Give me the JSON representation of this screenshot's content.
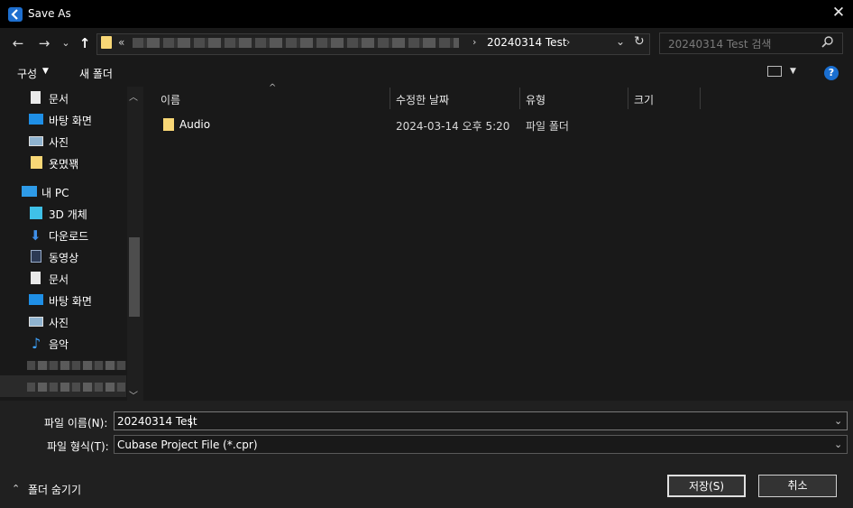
{
  "window": {
    "title": "Save As",
    "close": "✕"
  },
  "nav": {
    "back": "←",
    "forward": "→",
    "recent": "⌄",
    "up": "↑",
    "address_overflow": "«",
    "address_current": "20240314 Test",
    "address_sep": "›",
    "search_placeholder": "20240314 Test 검색"
  },
  "toolbar": {
    "organize": "구성",
    "new_folder": "새 폴더",
    "help": "?"
  },
  "sidebar": {
    "items": [
      {
        "label": "문서",
        "icon": "document-icon"
      },
      {
        "label": "바탕 화면",
        "icon": "desktop-icon"
      },
      {
        "label": "사진",
        "icon": "pictures-icon"
      },
      {
        "label": "욧몄꽦",
        "icon": "folder-icon"
      },
      {
        "label": "내 PC",
        "icon": "pc-icon"
      },
      {
        "label": "3D 개체",
        "icon": "3d-objects-icon"
      },
      {
        "label": "다운로드",
        "icon": "download-icon"
      },
      {
        "label": "동영상",
        "icon": "video-icon"
      },
      {
        "label": "문서",
        "icon": "document-icon"
      },
      {
        "label": "바탕 화면",
        "icon": "desktop-icon"
      },
      {
        "label": "사진",
        "icon": "pictures-icon"
      },
      {
        "label": "음악",
        "icon": "music-icon"
      }
    ]
  },
  "filelist": {
    "columns": [
      "이름",
      "수정한 날짜",
      "유형",
      "크기"
    ],
    "rows": [
      {
        "name": "Audio",
        "modified": "2024-03-14 오후 5:20",
        "type": "파일 폴더",
        "size": ""
      }
    ]
  },
  "form": {
    "filename_label": "파일 이름(N):",
    "filename_value": "20240314 Test",
    "filetype_label": "파일 형식(T):",
    "filetype_value": "Cubase Project File (*.cpr)",
    "hide_folders": "폴더 숨기기",
    "save": "저장(S)",
    "cancel": "취소"
  }
}
